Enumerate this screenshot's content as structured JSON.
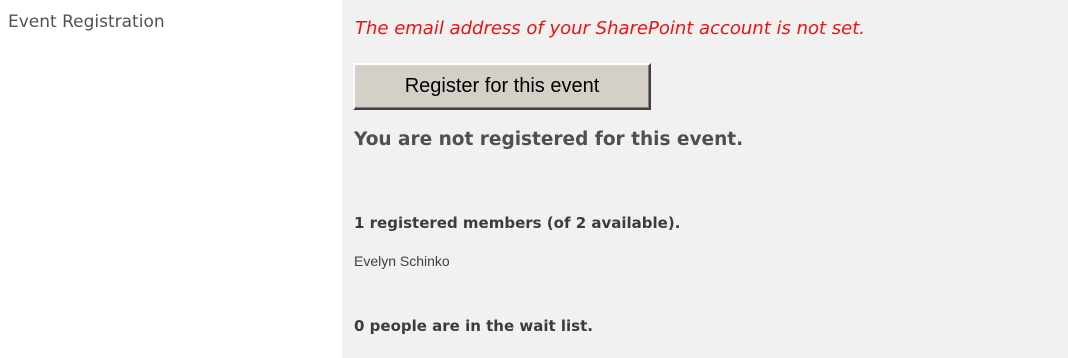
{
  "field": {
    "label": "Event Registration"
  },
  "registration": {
    "warning": "The email address of your SharePoint account is not set.",
    "register_button_label": "Register for this event",
    "status_text": "You are not registered for this event.",
    "members_summary": "1 registered members (of 2 available).",
    "members": [
      "Evelyn Schinko"
    ],
    "waitlist_text": "0 people are in the wait list."
  },
  "colors": {
    "warning_text": "#ee1111",
    "panel_background": "#f1f1f1",
    "button_face": "#d4d0c8"
  }
}
